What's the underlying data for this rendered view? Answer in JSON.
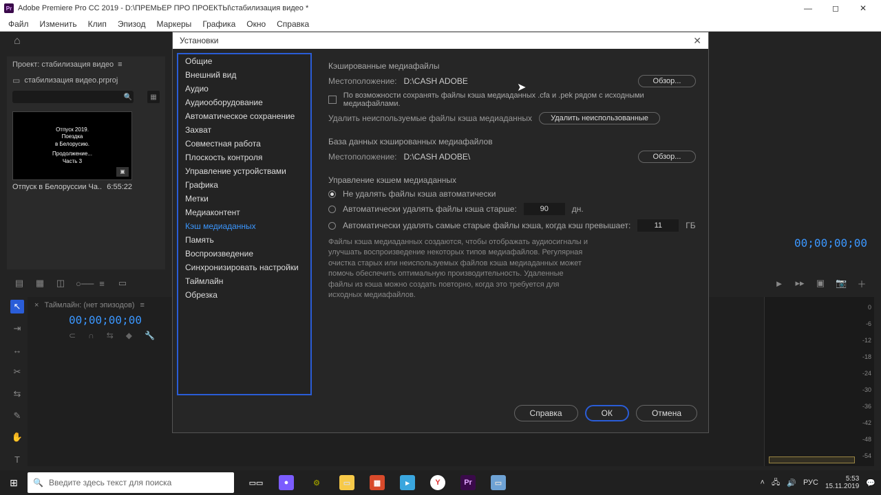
{
  "window": {
    "title": "Adobe Premiere Pro CC 2019 - D:\\ПРЕМЬЕР ПРО ПРОЕКТЫ\\стабилизация видео *",
    "app_abbrev": "Pr"
  },
  "menubar": [
    "Файл",
    "Изменить",
    "Клип",
    "Эпизод",
    "Маркеры",
    "Графика",
    "Окно",
    "Справка"
  ],
  "project_panel": {
    "tab": "Проект: стабилизация видео",
    "menu_glyph": "≡",
    "file": "стабилизация видео.prproj",
    "thumb_lines": [
      "Отпуск 2019.",
      "Поездка",
      "в Белорусию.",
      "",
      "Продолжение...",
      "Часть 3"
    ],
    "caption": "Отпуск в Белоруссии  Ча..",
    "duration": "6:55:22"
  },
  "dialog": {
    "title": "Установки",
    "sidebar_items": [
      "Общие",
      "Внешний вид",
      "Аудио",
      "Аудиооборудование",
      "Автоматическое сохранение",
      "Захват",
      "Совместная работа",
      "Плоскость контроля",
      "Управление устройствами",
      "Графика",
      "Метки",
      "Медиаконтент",
      "Кэш медиаданных",
      "Память",
      "Воспроизведение",
      "Синхронизировать настройки",
      "Таймлайн",
      "Обрезка"
    ],
    "selected_index": 12,
    "section1_title": "Кэшированные медиафайлы",
    "loc_label": "Местоположение:",
    "loc_value1": "D:\\CASH ADOBE",
    "browse": "Обзор...",
    "checkbox_label": "По возможности сохранять файлы кэша медиаданных .cfa и .pek рядом с исходными медиафайлами.",
    "delete_unused_label": "Удалить неиспользуемые файлы кэша медиаданных",
    "delete_unused_btn": "Удалить неиспользованные",
    "section2_title": "База данных кэшированных медиафайлов",
    "loc_value2": "D:\\CASH ADOBE\\",
    "section3_title": "Управление кэшем медиаданных",
    "radio1": "Не удалять файлы кэша автоматически",
    "radio2_prefix": "Автоматически удалять файлы кэша старше:",
    "radio2_value": "90",
    "radio2_unit": "дн.",
    "radio3_prefix": "Автоматически удалять самые старые файлы кэша, когда кэш превышает:",
    "radio3_value": "11",
    "radio3_unit": "ГБ",
    "description": "Файлы кэша медиаданных создаются, чтобы отображать аудиосигналы и улучшать воспроизведение некоторых типов медиафайлов. Регулярная очистка старых или неиспользуемых файлов кэша медиаданных может помочь обеспечить оптимальную производительность. Удаленные файлы из кэша можно создать повторно, когда это требуется для исходных медиафайлов.",
    "footer_help": "Справка",
    "footer_ok": "ОК",
    "footer_cancel": "Отмена"
  },
  "right_timecode": "00;00;00;00",
  "timeline": {
    "tab": "Таймлайн: (нет эпизодов)",
    "menu_glyph": "≡",
    "timecode": "00;00;00;00",
    "scale": [
      "0",
      "-6",
      "-12",
      "-18",
      "-24",
      "-30",
      "-36",
      "-42",
      "-48",
      "-54"
    ]
  },
  "taskbar": {
    "search_placeholder": "Введите здесь текст для поиска",
    "lang": "РУС",
    "time": "5:53",
    "date": "15.11.2019"
  }
}
